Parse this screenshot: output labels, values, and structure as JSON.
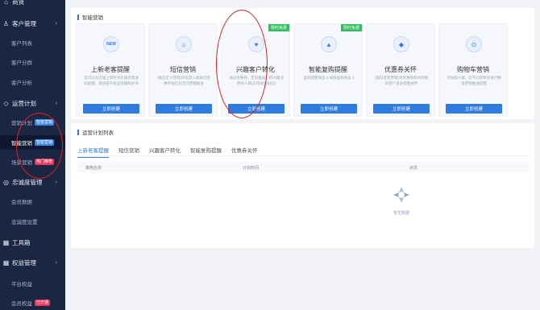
{
  "sidebar": {
    "top_item": "商贤",
    "groups": [
      {
        "icon": "user-icon",
        "label": "客户管理"
      },
      {
        "icon": "diamond-icon",
        "label": "运营计划"
      },
      {
        "icon": "gear-icon",
        "label": "忠诚度管理"
      },
      {
        "icon": "grid-icon",
        "label": "工具箱"
      },
      {
        "icon": "grid-icon",
        "label": "权益管理"
      }
    ],
    "items": [
      {
        "label": "客户列表"
      },
      {
        "label": "客户分群"
      },
      {
        "label": "客户分析"
      },
      {
        "label": "营销计划",
        "tag": "智能营销"
      },
      {
        "label": "智能营销",
        "tag": "智能营销"
      },
      {
        "label": "场景营销",
        "tag": "热门推荐"
      },
      {
        "label": "会员数据"
      },
      {
        "label": "忠诚度设置"
      },
      {
        "label": "平台权益"
      },
      {
        "label": "会员权益",
        "tag": "已开通"
      }
    ]
  },
  "smart": {
    "section_title": "智能营销",
    "cards": [
      {
        "icon": "new-icon",
        "icon_text": "NEW",
        "title": "上新老客提醒",
        "desc": "您可以在店铺上新时对店铺老客通知提醒，快速提升新品销量和好评",
        "button": "立即创建",
        "corner": ""
      },
      {
        "icon": "message-icon",
        "icon_text": "⌂",
        "title": "短信营销",
        "desc": "(微信定义营销)对指定人群进行优惠券短信及定向营销推送",
        "button": "立即创建",
        "corner": ""
      },
      {
        "icon": "heart-icon",
        "icon_text": "♥",
        "title": "兴趣客户转化",
        "desc": "通过优惠券、定向推送，把兴趣消费的人群(支持发送短信)",
        "button": "立即创建",
        "corner": "限时免费"
      },
      {
        "icon": "bell-icon",
        "icon_text": "▲",
        "title": "智能复购提醒",
        "desc": "复购提醒商品 0 关联复购商品 0",
        "button": "立即创建",
        "corner": "限时免费"
      },
      {
        "icon": "coupon-icon",
        "icon_text": "◆",
        "title": "优惠券关怀",
        "desc": "(面向老客营销)对优惠券即将到期的客户发送提醒关怀",
        "button": "立即创建",
        "corner": ""
      },
      {
        "icon": "cart-icon",
        "icon_text": "⊙",
        "title": "购物车营销",
        "desc": "对加购人群，在不同购物车进行精准营销推送提醒",
        "button": "立即创建",
        "corner": ""
      }
    ]
  },
  "plans": {
    "section_title": "运营计划列表",
    "tabs": [
      "上新老客提醒",
      "短信营销",
      "兴趣客户转化",
      "智能复购提醒",
      "优惠券关怀"
    ],
    "columns": [
      "策略名称",
      "计划时间",
      "状态"
    ],
    "empty_text": "暂无数据"
  },
  "colors": {
    "accent": "#2f7ce0",
    "sidebar": "#1b2642",
    "annotation": "#e02020"
  }
}
